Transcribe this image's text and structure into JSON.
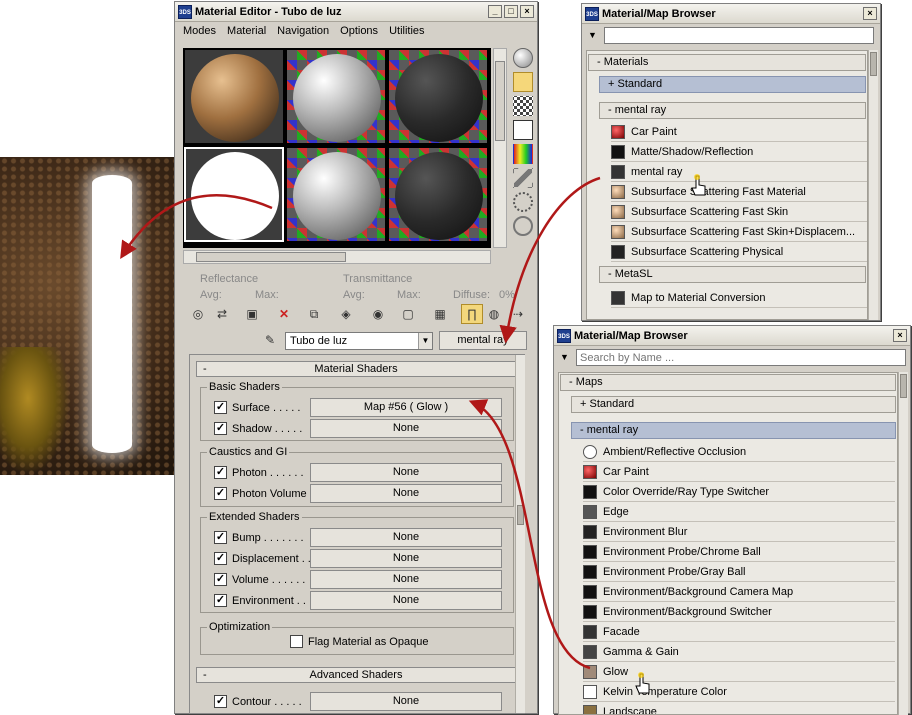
{
  "material_editor": {
    "title": "Material Editor - Tubo de luz",
    "menu": [
      "Modes",
      "Material",
      "Navigation",
      "Options",
      "Utilities"
    ],
    "labels": {
      "reflectance": "Reflectance",
      "transmittance": "Transmittance",
      "avg": "Avg:",
      "max": "Max:",
      "diffuse": "Diffuse:",
      "diffuse_val": "0%"
    },
    "material_name": "Tubo de luz",
    "material_type": "mental ray",
    "rollout_material_shaders": "Material Shaders",
    "rollout_advanced_shaders": "Advanced Shaders",
    "groups": {
      "basic": "Basic Shaders",
      "caustics": "Caustics and GI",
      "extended": "Extended Shaders",
      "optimization": "Optimization"
    },
    "shaders": {
      "surface": {
        "label": "Surface . . . . .",
        "value": "Map #56  ( Glow )"
      },
      "shadow": {
        "label": "Shadow . . . . .",
        "value": "None"
      },
      "photon": {
        "label": "Photon . . . . . .",
        "value": "None"
      },
      "photon_volume": {
        "label": "Photon Volume .",
        "value": "None"
      },
      "bump": {
        "label": "Bump . . . . . . .",
        "value": "None"
      },
      "displacement": {
        "label": "Displacement . .",
        "value": "None"
      },
      "volume": {
        "label": "Volume . . . . . .",
        "value": "None"
      },
      "environment": {
        "label": "Environment . .",
        "value": "None"
      },
      "contour": {
        "label": "Contour . . . . .",
        "value": "None"
      }
    },
    "flag_opaque": "Flag Material as Opaque"
  },
  "browser_top": {
    "title": "Material/Map Browser",
    "search_value": "",
    "categories": {
      "materials": "- Materials",
      "standard": "+ Standard",
      "mentalray": "- mental ray",
      "metasl": "- MetaSL"
    },
    "items": [
      {
        "label": "Car Paint"
      },
      {
        "label": "Matte/Shadow/Reflection"
      },
      {
        "label": "mental ray"
      },
      {
        "label": "Subsurface Scattering Fast Material"
      },
      {
        "label": "Subsurface Scattering Fast Skin"
      },
      {
        "label": "Subsurface Scattering Fast Skin+Displacem..."
      },
      {
        "label": "Subsurface Scattering Physical"
      }
    ],
    "metasl_items": [
      {
        "label": "Map to Material Conversion"
      }
    ]
  },
  "browser_bottom": {
    "title": "Material/Map Browser",
    "search_placeholder": "Search by Name ...",
    "categories": {
      "maps": "- Maps",
      "standard": "+ Standard",
      "mentalray": "- mental ray"
    },
    "items": [
      {
        "label": "Ambient/Reflective Occlusion"
      },
      {
        "label": "Car Paint"
      },
      {
        "label": "Color Override/Ray Type Switcher"
      },
      {
        "label": "Edge"
      },
      {
        "label": "Environment Blur"
      },
      {
        "label": "Environment Probe/Chrome Ball"
      },
      {
        "label": "Environment Probe/Gray Ball"
      },
      {
        "label": "Environment/Background Camera Map"
      },
      {
        "label": "Environment/Background Switcher"
      },
      {
        "label": "Facade"
      },
      {
        "label": "Gamma & Gain"
      },
      {
        "label": "Glow"
      },
      {
        "label": "Kelvin Temperature Color"
      },
      {
        "label": "Landscape"
      }
    ]
  },
  "colors": {
    "arrow": "#b01818",
    "highlight": "#b5bfd3",
    "window_bg": "#d4d0c8"
  }
}
